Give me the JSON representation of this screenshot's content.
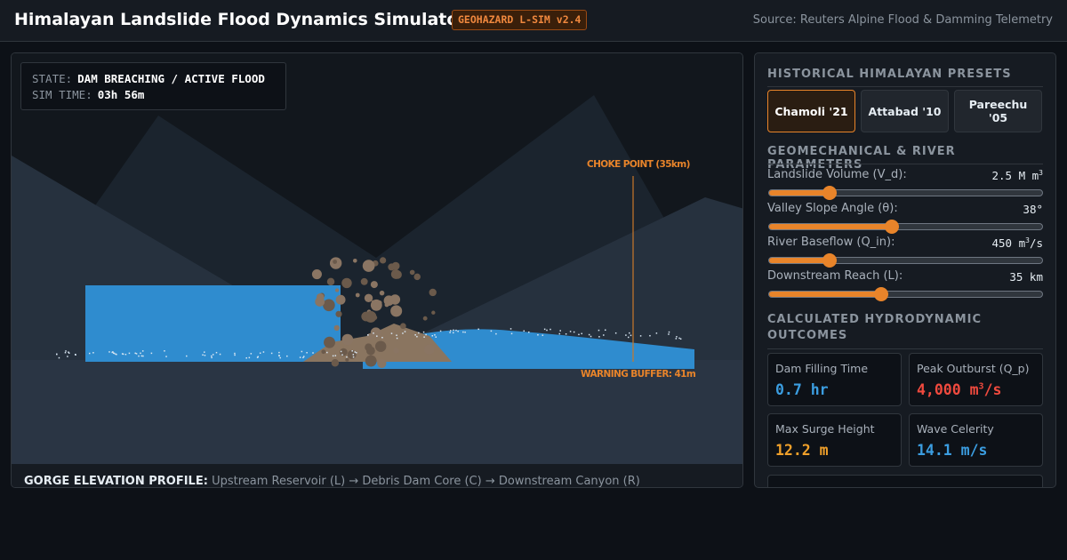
{
  "header": {
    "title": "Himalayan Landslide Flood Dynamics Simulator",
    "badge": "GEOHAZARD L-SIM v2.4",
    "source": "Source: Reuters Alpine Flood & Damming Telemetry"
  },
  "simulation": {
    "state_label": "STATE:",
    "state_value": "DAM BREACHING / ACTIVE FLOOD",
    "time_label": "SIM TIME:",
    "time_value": "03h 56m",
    "choke_point_label": "CHOKE POINT (35km)",
    "warning_buffer_label": "WARNING BUFFER: 41m",
    "profile_title": "GORGE ELEVATION PROFILE:",
    "profile_text": "Upstream Reservoir (L) → Debris Dam Core (C) → Downstream Canyon (R)"
  },
  "presets": {
    "title": "HISTORICAL HIMALAYAN PRESETS",
    "items": [
      {
        "label": "Chamoli '21",
        "active": true
      },
      {
        "label": "Attabad '10",
        "active": false
      },
      {
        "label": "Pareechu '05",
        "active": false
      }
    ]
  },
  "parameters": {
    "title": "GEOMECHANICAL & RIVER PARAMETERS",
    "items": [
      {
        "label": "Landslide Volume (V_d):",
        "value": "2.5 M m",
        "unit_sup": "3",
        "value_suffix": "",
        "level": 0.22
      },
      {
        "label": "Valley Slope Angle (θ):",
        "value": "38°",
        "unit_sup": "",
        "value_suffix": "",
        "level": 0.45
      },
      {
        "label": "River Baseflow (Q_in):",
        "value": "450 m",
        "unit_sup": "3",
        "value_suffix": "/s",
        "level": 0.22
      },
      {
        "label": "Downstream Reach (L):",
        "value": "35 km",
        "unit_sup": "",
        "value_suffix": "",
        "level": 0.41
      }
    ]
  },
  "outcomes": {
    "title": "CALCULATED HYDRODYNAMIC OUTCOMES",
    "items": [
      {
        "label": "Dam Filling Time",
        "value": "0.7 hr",
        "unit_sup": "",
        "value_suffix": "",
        "color": "#3b9de0"
      },
      {
        "label": "Peak Outburst (Q_p)",
        "value": "4,000 m",
        "unit_sup": "3",
        "value_suffix": "/s",
        "color": "#f04a3e"
      },
      {
        "label": "Max Surge Height",
        "value": "12.2 m",
        "unit_sup": "",
        "value_suffix": "",
        "color": "#f0a02a"
      },
      {
        "label": "Wave Celerity",
        "value": "14.1 m/s",
        "unit_sup": "",
        "value_suffix": "",
        "color": "#3b9de0"
      }
    ]
  },
  "colors": {
    "accent": "#e8842a",
    "water": "#2f8ccf",
    "debris": "#8a7560",
    "danger": "#f04a3e"
  }
}
